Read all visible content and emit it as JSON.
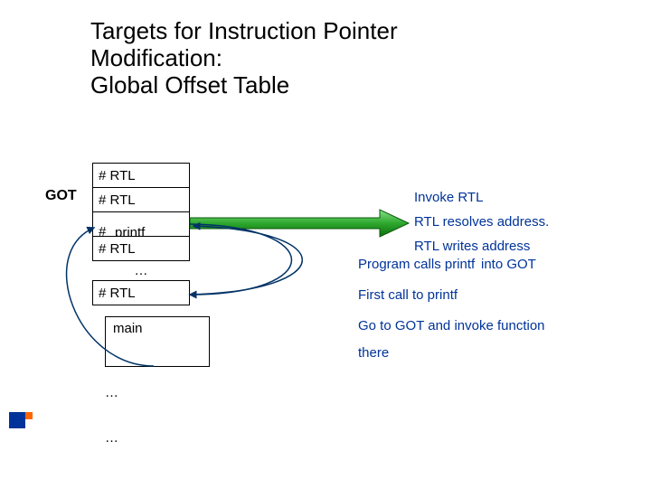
{
  "title_line1": "Targets for Instruction Pointer",
  "title_line2": "Modification:",
  "title_line3": "Global Offset Table",
  "got_label": "GOT",
  "cells": {
    "c0": "# RTL",
    "c1": "# RTL",
    "c2a": "# RTL",
    "c2b": "printf",
    "c3": "# RTL",
    "c4": "# RTL"
  },
  "dots": "…",
  "main_label": "main",
  "after1": "…",
  "after2": "…",
  "lines": {
    "l_invoke": "Invoke RTL",
    "l_resolves": "RTL resolves address.",
    "l_writes_a": "RTL writes address",
    "l_writes_b": "into GOT",
    "l_calls": "Program calls printf",
    "l_first": "First call to printf",
    "l_goto": "Go to GOT and invoke function",
    "l_there": "there"
  }
}
